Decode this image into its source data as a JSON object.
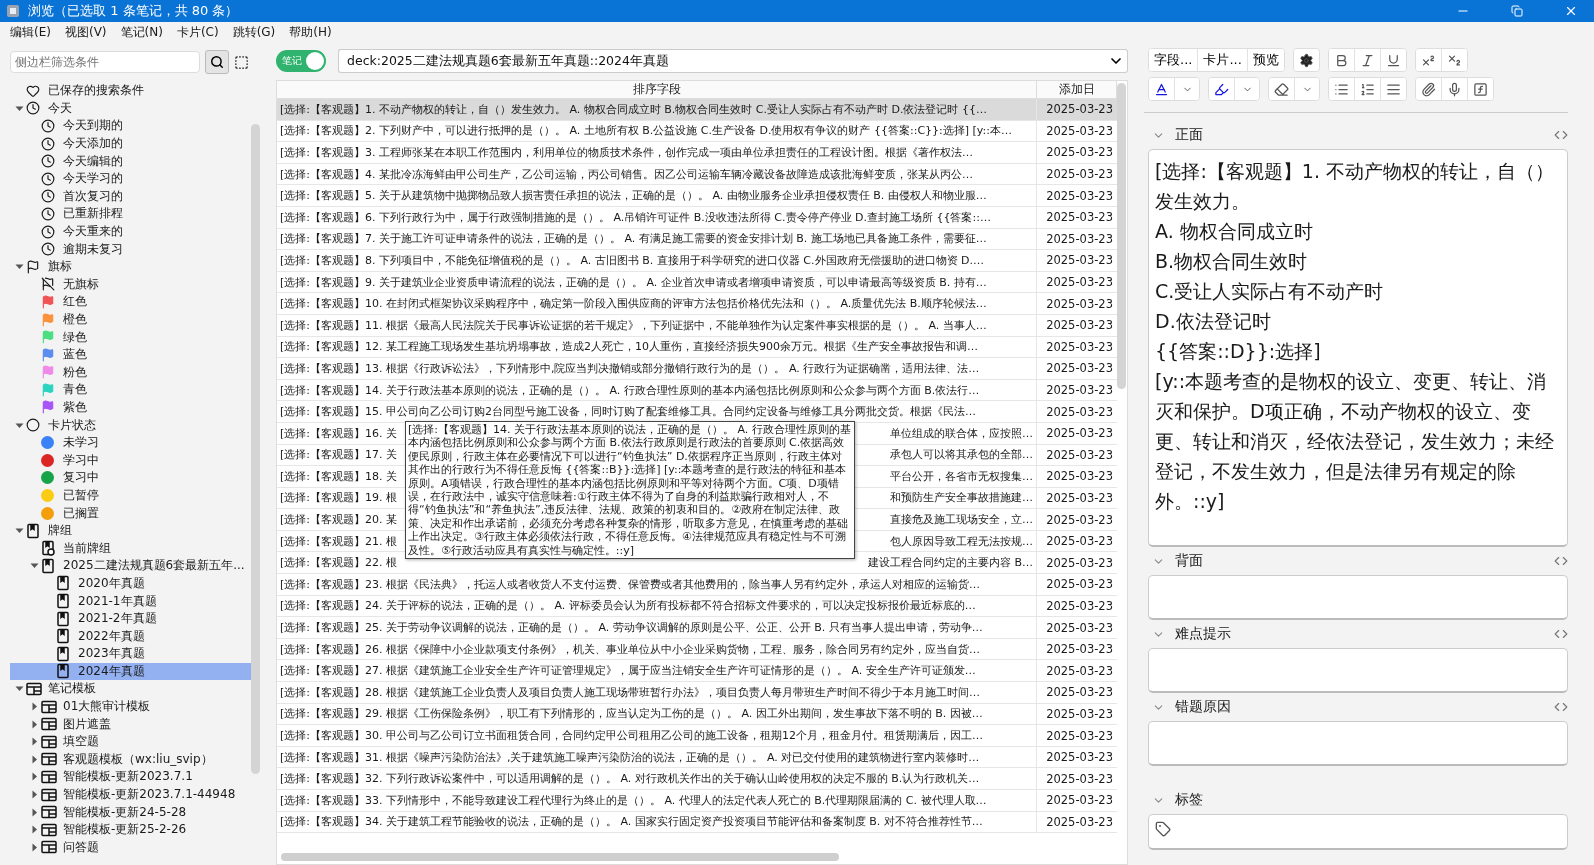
{
  "window": {
    "title": "浏览（已选取 1 条笔记，共 80 条）"
  },
  "menu": [
    "编辑(E)",
    "视图(V)",
    "笔记(N)",
    "卡片(C)",
    "跳转(G)",
    "帮助(H)"
  ],
  "sidebar": {
    "search": {
      "placeholder": "侧边栏筛选条件"
    },
    "items": [
      {
        "kind": "saved-search",
        "label": "已保存的搜索条件",
        "selected": false
      },
      {
        "kind": "today",
        "label": "今天",
        "selected": false,
        "expanded": true,
        "children": [
          {
            "kind": "clock",
            "label": "今天到期的",
            "selected": false
          },
          {
            "kind": "clock",
            "label": "今天添加的",
            "selected": false
          },
          {
            "kind": "clock",
            "label": "今天编辑的",
            "selected": false
          },
          {
            "kind": "clock",
            "label": "今天学习的",
            "selected": false
          },
          {
            "kind": "clock",
            "label": "首次复习的",
            "selected": false
          },
          {
            "kind": "clock",
            "label": "已重新排程",
            "selected": false
          },
          {
            "kind": "clock",
            "label": "今天重来的",
            "selected": false
          },
          {
            "kind": "clock",
            "label": "逾期未复习",
            "selected": false
          }
        ]
      },
      {
        "kind": "flags",
        "label": "旗标",
        "selected": false,
        "expanded": true,
        "children": [
          {
            "kind": "no-flag",
            "label": "无旗标",
            "selected": false
          },
          {
            "kind": "flag",
            "label": "红色",
            "selected": false,
            "color": "#f05454"
          },
          {
            "kind": "flag",
            "label": "橙色",
            "selected": false,
            "color": "#fb923c"
          },
          {
            "kind": "flag",
            "label": "绿色",
            "selected": false,
            "color": "#4ade80"
          },
          {
            "kind": "flag",
            "label": "蓝色",
            "selected": false,
            "color": "#5b8def"
          },
          {
            "kind": "flag",
            "label": "粉色",
            "selected": false,
            "color": "#f08ae8"
          },
          {
            "kind": "flag",
            "label": "青色",
            "selected": false,
            "color": "#2dd4bf"
          },
          {
            "kind": "flag",
            "label": "紫色",
            "selected": false,
            "color": "#a855f7"
          }
        ]
      },
      {
        "kind": "card-state",
        "label": "卡片状态",
        "selected": false,
        "expanded": true,
        "children": [
          {
            "kind": "state",
            "label": "未学习",
            "selected": false,
            "color": "#3b82f6"
          },
          {
            "kind": "state",
            "label": "学习中",
            "selected": false,
            "color": "#dc2626"
          },
          {
            "kind": "state",
            "label": "复习中",
            "selected": false,
            "color": "#16a34a"
          },
          {
            "kind": "state",
            "label": "已暂停",
            "selected": false,
            "color": "#facc15"
          },
          {
            "kind": "state",
            "label": "已搁置",
            "selected": false,
            "color": "#f59e0b"
          }
        ]
      },
      {
        "kind": "decks",
        "label": "牌组",
        "selected": false,
        "expanded": true,
        "children": [
          {
            "kind": "current-deck",
            "label": "当前牌组",
            "selected": false
          },
          {
            "kind": "deck",
            "label": "2025二建法规真题6套最新五年...",
            "selected": false,
            "expanded": true,
            "children": [
              {
                "kind": "deck",
                "label": "2020年真题",
                "selected": false
              },
              {
                "kind": "deck",
                "label": "2021-1年真题",
                "selected": false
              },
              {
                "kind": "deck",
                "label": "2021-2年真题",
                "selected": false
              },
              {
                "kind": "deck",
                "label": "2022年真题",
                "selected": false
              },
              {
                "kind": "deck",
                "label": "2023年真题",
                "selected": false
              },
              {
                "kind": "deck",
                "label": "2024年真题",
                "selected": true
              }
            ]
          }
        ]
      },
      {
        "kind": "note-types",
        "label": "笔记模板",
        "selected": false,
        "expanded": true,
        "children": [
          {
            "kind": "note-type",
            "label": "01大熊审计模板",
            "selected": false,
            "expanded": false
          },
          {
            "kind": "note-type",
            "label": "图片遮盖",
            "selected": false,
            "expanded": false
          },
          {
            "kind": "note-type",
            "label": "填空题",
            "selected": false,
            "expanded": false
          },
          {
            "kind": "note-type",
            "label": "客观题模板（wx:liu_svip）",
            "selected": false,
            "expanded": false
          },
          {
            "kind": "note-type",
            "label": "智能模板-更新2023.7.1",
            "selected": false,
            "expanded": false
          },
          {
            "kind": "note-type",
            "label": "智能模板-更新2023.7.1-44948",
            "selected": false,
            "expanded": false
          },
          {
            "kind": "note-type",
            "label": "智能模板-更新24-5-28",
            "selected": false,
            "expanded": false
          },
          {
            "kind": "note-type",
            "label": "智能模板-更新25-2-26",
            "selected": false,
            "expanded": false
          },
          {
            "kind": "note-type",
            "label": "问答题",
            "selected": false,
            "expanded": false
          }
        ]
      }
    ]
  },
  "toolbar": {
    "mode_toggle": {
      "label": "笔记",
      "on": true
    },
    "search": {
      "value": "deck:2025二建法规真题6套最新五年真题::2024年真题"
    }
  },
  "table": {
    "columns": [
      "排序字段",
      "添加日"
    ],
    "rows": [
      {
        "text": "[选择:【客观题】1. 不动产物权的转让，自（）发生效力。 A. 物权合同成立时 B.物权合同生效时 C.受让人实际占有不动产时 D.依法登记时 {{…",
        "date": "2025-03-23",
        "selected": true
      },
      {
        "text": "[选择:【客观题】2. 下列财产中，可以进行抵押的是（）。 A. 土地所有权 B.公益设施 C.生产设备 D.使用权有争议的财产 {{答案::C}}:选择] [y::本…",
        "date": "2025-03-23",
        "selected": false
      },
      {
        "text": "[选择:【客观题】3. 工程师张某在本职工作范围内，利用单位的物质技术条件，创作完成一项由单位承担责任的工程设计图。根据《著作权法…",
        "date": "2025-03-23",
        "selected": false
      },
      {
        "text": "[选择:【客观题】4. 某批冷冻海鲜由甲公司生产，乙公司运输，丙公司销售。因乙公司运输车辆冷藏设备故障造成该批海鲜变质，张某从丙公…",
        "date": "2025-03-23",
        "selected": false
      },
      {
        "text": "[选择:【客观题】5. 关于从建筑物中抛掷物品致人损害责任承担的说法，正确的是（）。 A. 由物业服务企业承担侵权责任 B. 由侵权人和物业服…",
        "date": "2025-03-23",
        "selected": false
      },
      {
        "text": "[选择:【客观题】6. 下列行政行为中，属于行政强制措施的是（）。 A.吊销许可证件 B.没收违法所得 C.责令停产停业 D.查封施工场所 {{答案::…",
        "date": "2025-03-23",
        "selected": false
      },
      {
        "text": "[选择:【客观题】7. 关于施工许可证申请条件的说法，正确的是（）。 A. 有满足施工需要的资金安排计划 B. 施工场地已具备施工条件，需要征…",
        "date": "2025-03-23",
        "selected": false
      },
      {
        "text": "[选择:【客观题】8. 下列项目中，不能免征增值税的是（）。 A. 古旧图书 B. 直接用于科学研究的进口仪器 C.外国政府无偿援助的进口物资 D.…",
        "date": "2025-03-23",
        "selected": false
      },
      {
        "text": "[选择:【客观题】9. 关于建筑业企业资质申请流程的说法，正确的是（）。 A. 企业首次申请或者增项申请资质，可以申请最高等级资质 B. 持有…",
        "date": "2025-03-23",
        "selected": false
      },
      {
        "text": "[选择:【客观题】10. 在封闭式框架协议采购程序中，确定第一阶段入围供应商的评审方法包括价格优先法和（）。 A.质量优先法 B.顺序轮候法…",
        "date": "2025-03-23",
        "selected": false
      },
      {
        "text": "[选择:【客观题】11. 根据《最高人民法院关于民事诉讼证据的若干规定》，下列证据中，不能单独作为认定案件事实根据的是（）。 A. 当事人…",
        "date": "2025-03-23",
        "selected": false
      },
      {
        "text": "[选择:【客观题】12. 某工程施工现场发生基坑坍塌事故，造成2人死亡，10人重伤，直接经济损失900余万元。根据《生产安全事故报告和调…",
        "date": "2025-03-23",
        "selected": false
      },
      {
        "text": "[选择:【客观题】13. 根据《行政诉讼法》，下列情形中,院应当判决撤销或部分撤销行政行为的是（）。 A. 行政行为证据确凿，适用法律、法…",
        "date": "2025-03-23",
        "selected": false
      },
      {
        "text": "[选择:【客观题】14. 关于行政法基本原则的说法，正确的是（）。 A. 行政合理性原则的基本内涵包括比例原则和公众参与两个方面 B.依法行…",
        "date": "2025-03-23",
        "selected": false
      },
      {
        "text": "[选择:【客观题】15. 甲公司向乙公司订购2台同型号施工设备，同时订购了配套维修工具。合同约定设备与维修工具分两批交货。根据《民法…",
        "date": "2025-03-23",
        "selected": false
      },
      {
        "text": "[选择:【客观题】16. 关",
        "text_end": "单位组成的联合体，应按照…",
        "date": "2025-03-23",
        "selected": false
      },
      {
        "text": "[选择:【客观题】17. 关",
        "text_end": "承包人可以将其承包的全部…",
        "date": "2025-03-23",
        "selected": false
      },
      {
        "text": "[选择:【客观题】18. 关",
        "text_end": "平台公开，各省市无权搜集…",
        "date": "2025-03-23",
        "selected": false
      },
      {
        "text": "[选择:【客观题】19. 根",
        "text_end": "和预防生产安全事故措施建…",
        "date": "2025-03-23",
        "selected": false
      },
      {
        "text": "[选择:【客观题】20. 某",
        "text_end": "直接危及施工现场安全，立…",
        "date": "2025-03-23",
        "selected": false
      },
      {
        "text": "[选择:【客观题】21. 根",
        "text_end": "包人原因导致工程无法按规…",
        "date": "2025-03-23",
        "selected": false
      },
      {
        "text": "[选择:【客观题】22. 根",
        "text_end": "建设工程合同约定的主要内容 B…",
        "date": "2025-03-23",
        "selected": false
      },
      {
        "text": "[选择:【客观题】23. 根据《民法典》，托运人或者收货人不支付运费、保管费或者其他费用的，除当事人另有约定外，承运人对相应的运输货…",
        "date": "2025-03-23",
        "selected": false
      },
      {
        "text": "[选择:【客观题】24. 关于评标的说法，正确的是（）。 A. 评标委员会认为所有投标都不符合招标文件要求的，可以决定投标报价最近标底的…",
        "date": "2025-03-23",
        "selected": false
      },
      {
        "text": "[选择:【客观题】25. 关于劳动争议调解的说法，正确的是（）。 A. 劳动争议调解的原则是公平、公正、公开 B. 只有当事人提出申请，劳动争…",
        "date": "2025-03-23",
        "selected": false
      },
      {
        "text": "[选择:【客观题】26. 根据《保障中小企业款项支付条例》，机关、事业单位从中小企业采购货物，工程、服务，除合同另有约定外，应当自货…",
        "date": "2025-03-23",
        "selected": false
      },
      {
        "text": "[选择:【客观题】27. 根据《建筑施工企业安全生产许可证管理规定》，属于应当注销安全生产许可证情形的是（）。 A. 安全生产许可证颁发…",
        "date": "2025-03-23",
        "selected": false
      },
      {
        "text": "[选择:【客观题】28. 根据《建筑施工企业负责人及项目负责人施工现场带班暂行办法》，项目负责人每月带班生产时间不得少于本月施工时间…",
        "date": "2025-03-23",
        "selected": false
      },
      {
        "text": "[选择:【客观题】29. 根据《工伤保险条例》，职工有下列情形的，应当认定为工伤的是（）。 A. 因工外出期间，发生事故下落不明的 B. 因被…",
        "date": "2025-03-23",
        "selected": false
      },
      {
        "text": "[选择:【客观题】30. 甲公司与乙公司订立书面租赁合同，合同约定甲公司租用乙公司的施工设备，租期12个月，租金月付。租赁期满后，因工…",
        "date": "2025-03-23",
        "selected": false
      },
      {
        "text": "[选择:【客观题】31. 根据《噪声污染防治法》,关于建筑施工噪声污染防治的说法，正确的是（）。 A. 对已交付使用的建筑物进行室内装修时…",
        "date": "2025-03-23",
        "selected": false
      },
      {
        "text": "[选择:【客观题】32. 下列行政诉讼案件中，可以适用调解的是（）。 A. 对行政机关作出的关于确认山岭使用权的决定不服的 B.认为行政机关…",
        "date": "2025-03-23",
        "selected": false
      },
      {
        "text": "[选择:【客观题】33. 下列情形中，不能导致建设工程代理行为终止的是（）。 A. 代理人的法定代表人死亡的 B.代理期限届满的 C. 被代理人取…",
        "date": "2025-03-23",
        "selected": false
      },
      {
        "text": "[选择:【客观题】34. 关于建筑工程节能验收的说法，正确的是（）。 A. 国家实行固定资产投资项目节能评估和备案制度 B. 对不符合推荐性节…",
        "date": "2025-03-23",
        "selected": false
      }
    ],
    "tooltip": "[选择:【客观题】14. 关于行政法基本原则的说法，正确的是（）。 A. 行政合理性原则的基本内涵包括比例原则和公众参与两个方面 B.依法行政原则是行政法的首要原则 C.依据高效便民原则，行政主体在必要情况下可以进行“钓鱼执法” D.依据程序正当原则，行政主体对其作出的行政行为不得任意反悔 {{答案::B}}:选择] [y::本题考查的是行政法的特征和基本原则。A项错误，行政合理性的基本内涵包括比例原则和平等对待两个方面。C项、D项错误，在行政法中，诚实守信意味着:①行政主体不得为了自身的利益欺骗行政相对人，不得“钓鱼执法”和“养鱼执法”,违反法律、法规、政策的初衷和目的。②政府在制定法律、政策、决定和作出承诺前，必须充分考虑各种复杂的情形，听取多方意见，在慎重考虑的基础上作出决定。③行政主体必须依法行政，不得任意反悔。④法律规范应具有稳定性与不可溯及性。⑤行政活动应具有真实性与确定性。::y]"
  },
  "editor": {
    "toolbar": {
      "buttons": [
        "字段...",
        "卡片...",
        "预览"
      ]
    },
    "fields": [
      {
        "label": "正面",
        "lines": [
          "[选择:【客观题】1. 不动产物权的转让，自（）发生效力。",
          "A. 物权合同成立时",
          "B.物权合同生效时",
          "C.受让人实际占有不动产时",
          "D.依法登记时",
          "{{答案::D}}:选择]",
          "[y::本题考查的是物权的设立、变更、转让、消灭和保护。D项正确，不动产物权的设立、变更、转让和消灭，经依法登记，发生效力；未经登记，不发生效力，但是法律另有规定的除外。::y]"
        ]
      },
      {
        "label": "背面"
      },
      {
        "label": "难点提示"
      },
      {
        "label": "错题原因"
      }
    ],
    "tags": {
      "label": "标签"
    }
  }
}
